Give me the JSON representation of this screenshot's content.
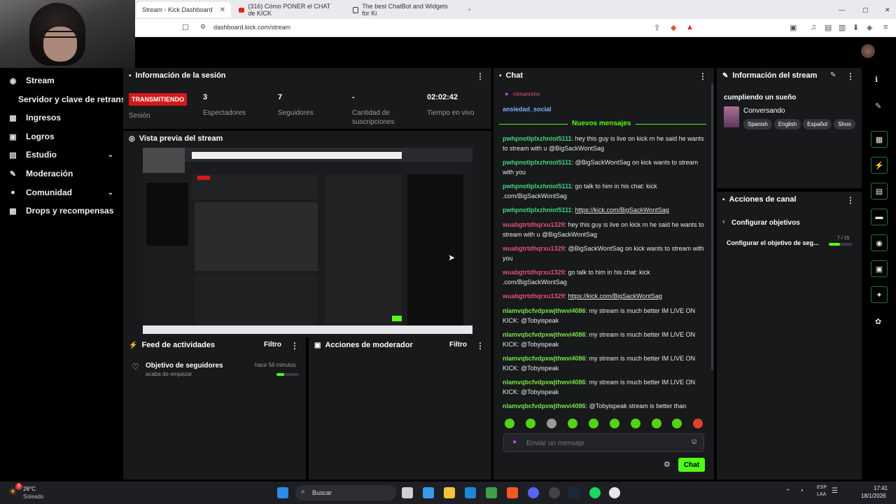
{
  "browser": {
    "tabs": [
      {
        "label": "Stream - Kick Dashboard"
      },
      {
        "label": "(316) Cómo PONER el CHAT de KICK"
      },
      {
        "label": "The best ChatBot and Widgets for Ki"
      }
    ],
    "url": "dashboard.kick.com/stream"
  },
  "sidebar": {
    "items": [
      {
        "label": "Stream",
        "icon": "stream-icon"
      },
      {
        "label": "Servidor y clave de retransm"
      },
      {
        "label": "Ingresos",
        "icon": "chart-icon"
      },
      {
        "label": "Logros",
        "icon": "trophy-icon"
      },
      {
        "label": "Estudio",
        "icon": "studio-icon"
      },
      {
        "label": "Moderación",
        "icon": "shield-icon"
      },
      {
        "label": "Comunidad",
        "icon": "community-icon"
      },
      {
        "label": "Drops y recompensas",
        "icon": "gift-icon"
      }
    ]
  },
  "session": {
    "title": "Información de la sesión",
    "status_badge": "TRANSMITIENDO",
    "status_label": "Sesión",
    "stats": [
      {
        "value": "3",
        "label": "Espectadores"
      },
      {
        "value": "7",
        "label": "Seguidores"
      },
      {
        "value": "-",
        "label": "Cantidad de suscripciones"
      },
      {
        "value": "02:02:42",
        "label": "Tiempo en vivo"
      }
    ]
  },
  "preview": {
    "title": "Vista previa del stream"
  },
  "activity": {
    "title": "Feed de actividades",
    "filter": "Filtro",
    "item_title": "Objetivo de seguidores",
    "item_sub": "acaba de empezar",
    "item_time": "hace 56 minutos",
    "progress": 0.35
  },
  "modactions": {
    "title": "Acciones de moderador",
    "filter": "Filtro"
  },
  "chat": {
    "title": "Chat",
    "pinned_user": "romanrimo",
    "pinned_user2": "ansiedad_social",
    "new_messages": "Nuevos mensajes",
    "messages": [
      {
        "user": "pwhpnotlplxzhniot5111",
        "text": "hey this guy is live on kick rn he said he wants to stream with u @BigSackWontSag"
      },
      {
        "user": "pwhpnotlplxzhniot5111",
        "text": "@BigSackWontSag on kick wants to stream with you"
      },
      {
        "user": "pwhpnotlplxzhniot5111",
        "text": "go talk to him in his chat: kick .com/BigSackWontSag"
      },
      {
        "user": "pwhpnotlplxzhniot5111",
        "text": "https://kick.com/BigSackWontSag"
      },
      {
        "user": "wuabgtrtdhqrxu1329",
        "text": "hey this guy is live on kick rn he said he wants to stream with u @BigSackWontSag"
      },
      {
        "user": "wuabgtrtdhqrxu1329",
        "text": "@BigSackWontSag on kick wants to stream with you"
      },
      {
        "user": "wuabgtrtdhqrxu1329",
        "text": "go talk to him in his chat: kick .com/BigSackWontSag"
      },
      {
        "user": "wuabgtrtdhqrxu1329",
        "text": "https://kick.com/BigSackWontSag"
      },
      {
        "user": "nlamvqbcfvdpxwjthwvi4086",
        "text": "my stream is much better IM LIVE ON KICK: @Tobyispeak"
      },
      {
        "user": "nlamvqbcfvdpxwjthwvi4086",
        "text": "my stream is much better IM LIVE ON KICK: @Tobyispeak"
      },
      {
        "user": "nlamvqbcfvdpxwjthwvi4086",
        "text": "my stream is much better IM LIVE ON KICK: @Tobyispeak"
      },
      {
        "user": "nlamvqbcfvdpxwjthwvi4086",
        "text": "my stream is much better IM LIVE ON KICK: @Tobyispeak"
      },
      {
        "user": "nlamvqbcfvdpxwjthwvi4086",
        "text": "@Tobyispeak stream is better than"
      }
    ],
    "input_placeholder": "Enviar un mensaje",
    "send_label": "Chat"
  },
  "stream_info": {
    "title": "Información del stream",
    "stream_title": "cumpliendo un sueño",
    "category": "Conversando",
    "tags": [
      "Spanish",
      "English",
      "Español",
      "Shoo"
    ]
  },
  "channel_actions": {
    "title": "Acciones de canal",
    "back_label": "Configurar objetivos",
    "goal_label": "Configurar el objetivo de seg...",
    "goal_count": "7 / 15",
    "goal_progress": 0.47
  },
  "taskbar": {
    "weather_temp": "26°C",
    "weather_desc": "Soleado",
    "search_label": "Buscar",
    "notif_count": "5",
    "lang1": "ESP",
    "lang2": "LAA",
    "time": "17:41",
    "date": "18/1/2026"
  },
  "colors": {
    "kick_green": "#53fc18",
    "live_red": "#d31a1a"
  }
}
